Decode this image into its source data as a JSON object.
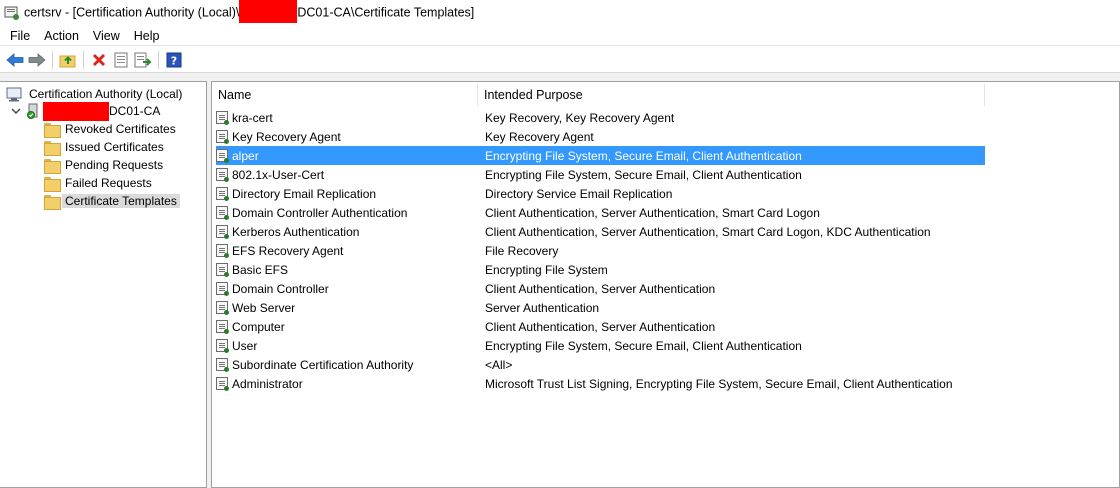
{
  "window": {
    "title_prefix": "certsrv - [Certification Authority (Local)\\",
    "title_suffix": "DC01-CA\\Certificate Templates]"
  },
  "menu": [
    "File",
    "Action",
    "View",
    "Help"
  ],
  "toolbar": {
    "icons": [
      "back-arrow-icon",
      "forward-arrow-icon",
      "up-folder-icon",
      "delete-icon",
      "properties-icon",
      "export-list-icon",
      "help-icon"
    ]
  },
  "tree": {
    "root": "Certification Authority (Local)",
    "ca_suffix": "DC01-CA",
    "items": [
      "Revoked Certificates",
      "Issued Certificates",
      "Pending Requests",
      "Failed Requests",
      "Certificate Templates"
    ],
    "selected_index": 4
  },
  "list": {
    "columns": [
      "Name",
      "Intended Purpose"
    ],
    "selected_index": 2,
    "rows": [
      [
        "kra-cert",
        "Key Recovery, Key Recovery Agent"
      ],
      [
        "Key Recovery Agent",
        "Key Recovery Agent"
      ],
      [
        "alper",
        "Encrypting File System, Secure Email, Client Authentication"
      ],
      [
        "802.1x-User-Cert",
        "Encrypting File System, Secure Email, Client Authentication"
      ],
      [
        "Directory Email Replication",
        "Directory Service Email Replication"
      ],
      [
        "Domain Controller Authentication",
        "Client Authentication, Server Authentication, Smart Card Logon"
      ],
      [
        "Kerberos Authentication",
        "Client Authentication, Server Authentication, Smart Card Logon, KDC Authentication"
      ],
      [
        "EFS Recovery Agent",
        "File Recovery"
      ],
      [
        "Basic EFS",
        "Encrypting File System"
      ],
      [
        "Domain Controller",
        "Client Authentication, Server Authentication"
      ],
      [
        "Web Server",
        "Server Authentication"
      ],
      [
        "Computer",
        "Client Authentication, Server Authentication"
      ],
      [
        "User",
        "Encrypting File System, Secure Email, Client Authentication"
      ],
      [
        "Subordinate Certification Authority",
        "<All>"
      ],
      [
        "Administrator",
        "Microsoft Trust List Signing, Encrypting File System, Secure Email, Client Authentication"
      ]
    ]
  },
  "colors": {
    "selection": "#3399ff",
    "redaction": "#ff0000"
  }
}
